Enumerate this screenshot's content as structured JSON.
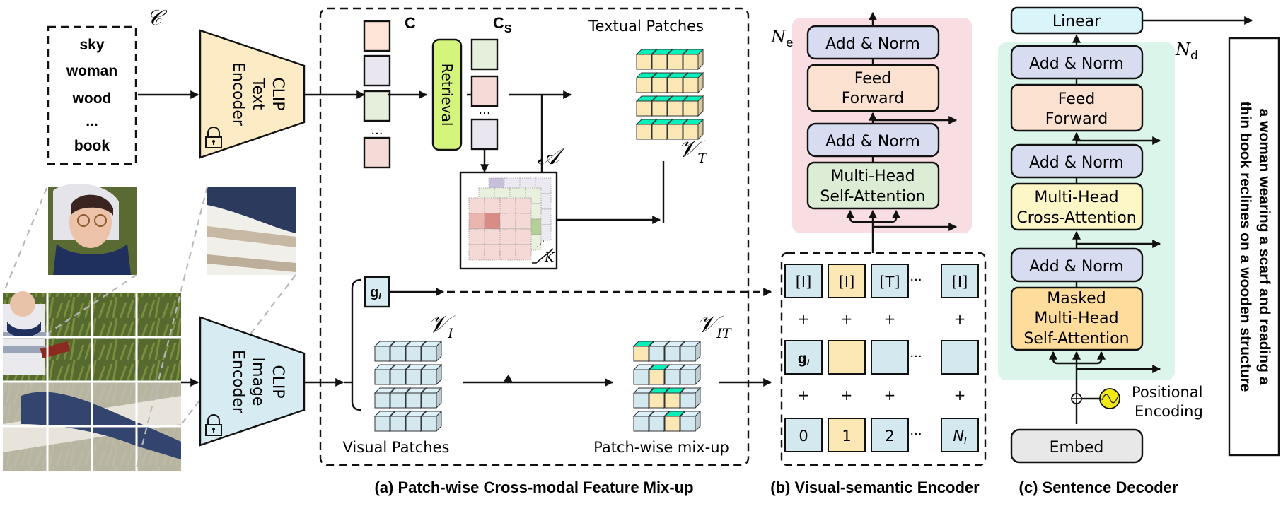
{
  "concepts": {
    "set_symbol": "𝒞",
    "words": [
      "sky",
      "woman",
      "wood",
      "...",
      "book"
    ]
  },
  "text_encoder": {
    "lines": [
      "CLIP",
      "Text",
      "Encoder"
    ],
    "icon": "lock-icon"
  },
  "image_encoder": {
    "lines": [
      "CLIP",
      "Image",
      "Encoder"
    ],
    "icon": "lock-icon"
  },
  "module_a": {
    "c_label": "C",
    "cs_label": "C",
    "cs_sub": "S",
    "retrieval_label": "Retrieval",
    "ellipsis": "...",
    "textual_patches_label": "Textual Patches",
    "vt_label": "𝒱",
    "vt_sub": "T",
    "attn_label": "𝒜",
    "k_label": "K",
    "gi_label": "g",
    "gi_sub": "I",
    "vi_label": "𝒱",
    "vi_sub": "I",
    "vit_label": "𝒱",
    "vit_sub": "IT",
    "visual_patches_label": "Visual Patches",
    "mixup_label": "Patch-wise mix-up",
    "mixed_cells": [
      [
        0,
        0
      ],
      [
        1,
        1
      ],
      [
        2,
        1
      ],
      [
        2,
        2
      ],
      [
        3,
        2
      ]
    ],
    "caption": "(a) Patch-wise Cross-modal Feature Mix-up"
  },
  "encoder": {
    "repeat_label": "N",
    "repeat_sub": "e",
    "blocks": {
      "add_norm_top": "Add & Norm",
      "feed_forward": [
        "Feed",
        "Forward"
      ],
      "add_norm_bottom": "Add & Norm",
      "mhsa": [
        "Multi-Head",
        "Self-Attention"
      ]
    },
    "tokens_row": [
      "[I]",
      "[I]",
      "[T]",
      "···",
      "[I]"
    ],
    "features_row": [
      "g",
      "",
      "",
      "···",
      ""
    ],
    "features_sub": "I",
    "positions_row": [
      "0",
      "1",
      "2",
      "···",
      "N"
    ],
    "positions_last_sub": "I",
    "plus": "+",
    "caption": "(b) Visual-semantic Encoder"
  },
  "decoder": {
    "linear": "Linear",
    "repeat_label": "N",
    "repeat_sub": "d",
    "blocks": {
      "add_norm_1": "Add & Norm",
      "feed_forward": [
        "Feed",
        "Forward"
      ],
      "add_norm_2": "Add & Norm",
      "cross_attn": [
        "Multi-Head",
        "Cross-Attention"
      ],
      "add_norm_3": "Add & Norm",
      "masked_attn": [
        "Masked",
        "Multi-Head",
        "Self-Attention"
      ]
    },
    "positional_encoding": [
      "Positional",
      "Encoding"
    ],
    "embed": "Embed",
    "caption": "(c) Sentence Decoder"
  },
  "output_sentence": [
    "a woman wearing a scarf and reading a",
    "thin book reclines on a wooden structure"
  ],
  "colors": {
    "text_encoder": "#fcebc4",
    "image_encoder": "#d6ebf2",
    "module_bg": "#f5f8fd",
    "retrieval": "#d4f47c",
    "c_peach": "#fde6d8",
    "c_lavender": "#e9e6ef",
    "c_green": "#e6efdb",
    "c_pink": "#f5dbd8",
    "yellow_patch": "#fbe7b4",
    "blue_patch": "#d4e8f0",
    "encoder_bg": "#f8dde2",
    "decoder_bg": "#dcf5ea",
    "add_norm": "#d7dcf0",
    "feed_forward": "#fbe1d0",
    "mhsa": "#dcecd5",
    "cross_attn": "#fdf7c7",
    "masked_attn": "#fddc9c",
    "linear": "#daf5fa",
    "embed": "#e8e8e8",
    "pos_enc": "#f1ea12",
    "tokens_bg": "#fbf9f4"
  }
}
